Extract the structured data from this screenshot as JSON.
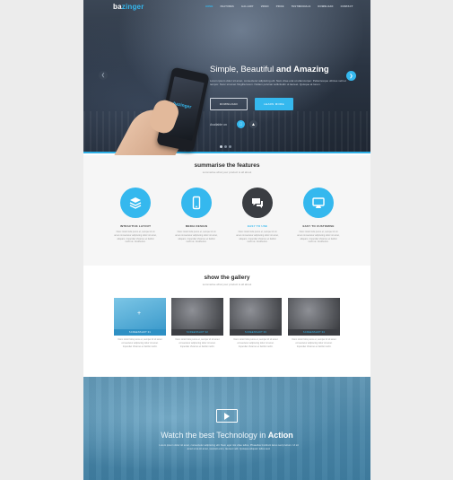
{
  "brand": {
    "logo_prefix": "ba",
    "logo_accent": "zinger",
    "accent_color": "#35b8ee"
  },
  "nav": {
    "items": [
      "HOME",
      "FEATURES",
      "GALLERY",
      "VIDEO",
      "PRICE",
      "TESTIMONIALS",
      "DOWNLOAD",
      "CONTACT"
    ],
    "active_index": 0
  },
  "hero": {
    "title_light": "Simple, Beautiful",
    "title_bold": "and Amazing",
    "text": "Lorem ipsum dolor sit amet, consectetur adipiscing elit. Nam vitae erat ut ullamcorper. Pellentesque ultrices velit et tempor. Nunc sit amet fringilla lorem. Nullam pulvinar sollicitudin ut laoreet. Quisque at lorem.",
    "download_label": "DOWNLOAD",
    "learn_label": "LEARN MORE",
    "available_label": "Available on",
    "phone_logo": "bazinger",
    "slides": 3,
    "active_slide": 0
  },
  "features": {
    "title": "summarise the features",
    "subtitle": "summarise what your product is all about",
    "items": [
      {
        "title": "INTRACTIVE LAYOUT",
        "icon": "layers-icon",
        "desc": "Nunc tortor felis purus et, semper id sit amet consectetur adipiscing dolor sit amet, aliquam. Imperdiet Vivamus et facilisi morbi at. Vestibulum."
      },
      {
        "title": "MEDIA DESIGN",
        "icon": "mobile-icon",
        "desc": "Nunc tortor felis purus et, semper id sit amet consectetur adipiscing dolor sit amet, aliquam. Imperdiet Vivamus et facilisi morbi at. Vestibulum."
      },
      {
        "title": "EASY TO USE",
        "icon": "chat-icon",
        "desc": "Nunc tortor felis purus et, semper id sit amet consectetur adipiscing dolor sit amet, aliquam. Imperdiet Vivamus et facilisi morbi at. Vestibulum."
      },
      {
        "title": "EASY TO CUSTOMISE",
        "icon": "screen-icon",
        "desc": "Nunc tortor felis purus et, semper id sit amet consectetur adipiscing dolor sit amet, aliquam. Imperdiet Vivamus et facilisi morbi at. Vestibulum."
      }
    ]
  },
  "gallery": {
    "title": "show the gallery",
    "subtitle": "summarise what your product is all about",
    "items": [
      {
        "caption": "SCREENSHOT 01",
        "desc": "Nunc tortor felis purus et, semper id sit amet consectetur adipiscing dolor sit amet. Imperdiet Vivamus et facilisi morbi."
      },
      {
        "caption": "SCREENSHOT 02",
        "desc": "Nunc tortor felis purus et, semper id sit amet consectetur adipiscing dolor sit amet. Imperdiet Vivamus et facilisi morbi."
      },
      {
        "caption": "SCREENSHOT 03",
        "desc": "Nunc tortor felis purus et, semper id sit amet consectetur adipiscing dolor sit amet. Imperdiet Vivamus et facilisi morbi."
      },
      {
        "caption": "SCREENSHOT 04",
        "desc": "Nunc tortor felis purus et, semper id sit amet consectetur adipiscing dolor sit amet. Imperdiet Vivamus et facilisi morbi."
      }
    ]
  },
  "video": {
    "title_light": "Watch the best Technology in",
    "title_bold": "Action",
    "text": "Lorem ipsum dolor sit amet, consectetur adipiscing elit. Nam eget nisi vitae tellus. Phasellus tincidunt lacus sed pretium. Ut sit amet urna sit amet, suscipit enim, laoreet velit. Quisque aliquam tellus sed."
  }
}
